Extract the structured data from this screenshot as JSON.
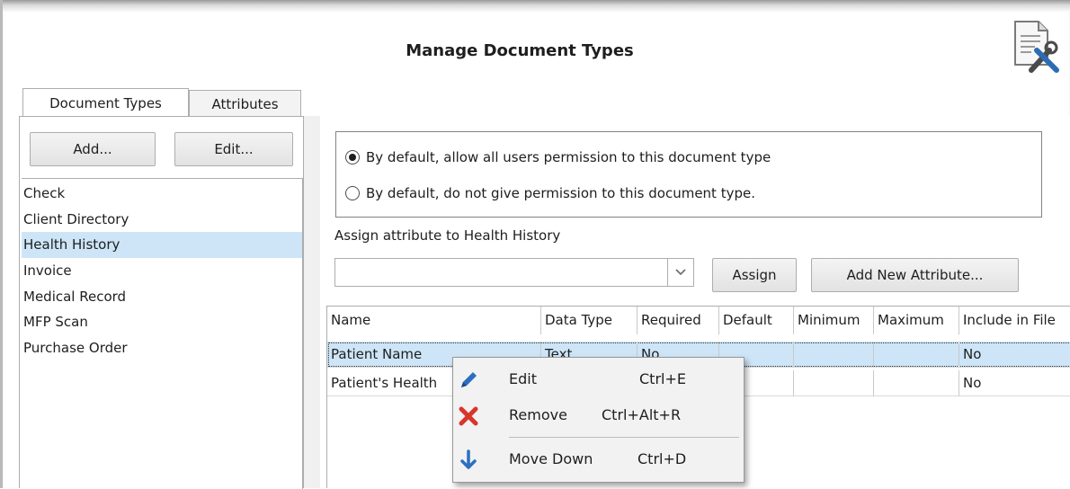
{
  "window": {
    "title": "Manage Document Types"
  },
  "tabs": [
    {
      "label": "Document Types",
      "active": true
    },
    {
      "label": "Attributes",
      "active": false
    }
  ],
  "left_panel": {
    "add_label": "Add...",
    "edit_label": "Edit...",
    "document_types": [
      {
        "label": "Check",
        "selected": false
      },
      {
        "label": "Client Directory",
        "selected": false
      },
      {
        "label": "Health History",
        "selected": true
      },
      {
        "label": "Invoice",
        "selected": false
      },
      {
        "label": "Medical Record",
        "selected": false
      },
      {
        "label": "MFP Scan",
        "selected": false
      },
      {
        "label": "Purchase Order",
        "selected": false
      }
    ]
  },
  "permissions": {
    "allow_label": "By default, allow all users permission to this document type",
    "deny_label": "By default, do not give permission to this document type.",
    "selected": "allow"
  },
  "assign": {
    "label": "Assign attribute to Health History",
    "combo_value": "",
    "assign_button": "Assign",
    "add_new_button": "Add New Attribute..."
  },
  "grid": {
    "columns": [
      "Name",
      "Data Type",
      "Required",
      "Default",
      "Minimum",
      "Maximum",
      "Include in File"
    ],
    "rows": [
      {
        "cells": [
          "Patient Name",
          "Text",
          "No",
          "",
          "",
          "",
          "No"
        ],
        "selected": true
      },
      {
        "cells": [
          "Patient's Health",
          "",
          "",
          "",
          "",
          "",
          "No"
        ],
        "selected": false
      }
    ]
  },
  "context_menu": {
    "items": [
      {
        "label": "Edit",
        "shortcut": "Ctrl+E",
        "icon": "pencil-icon"
      },
      {
        "label": "Remove",
        "shortcut": "Ctrl+Alt+R",
        "icon": "red-x-icon"
      },
      {
        "label": "Move Down",
        "shortcut": "Ctrl+D",
        "icon": "arrow-down-icon"
      }
    ]
  },
  "colors": {
    "selection": "#cde5f7",
    "remove_icon": "#d9352b",
    "edit_icon": "#2d6fc0",
    "move_icon": "#2d6fc0"
  }
}
